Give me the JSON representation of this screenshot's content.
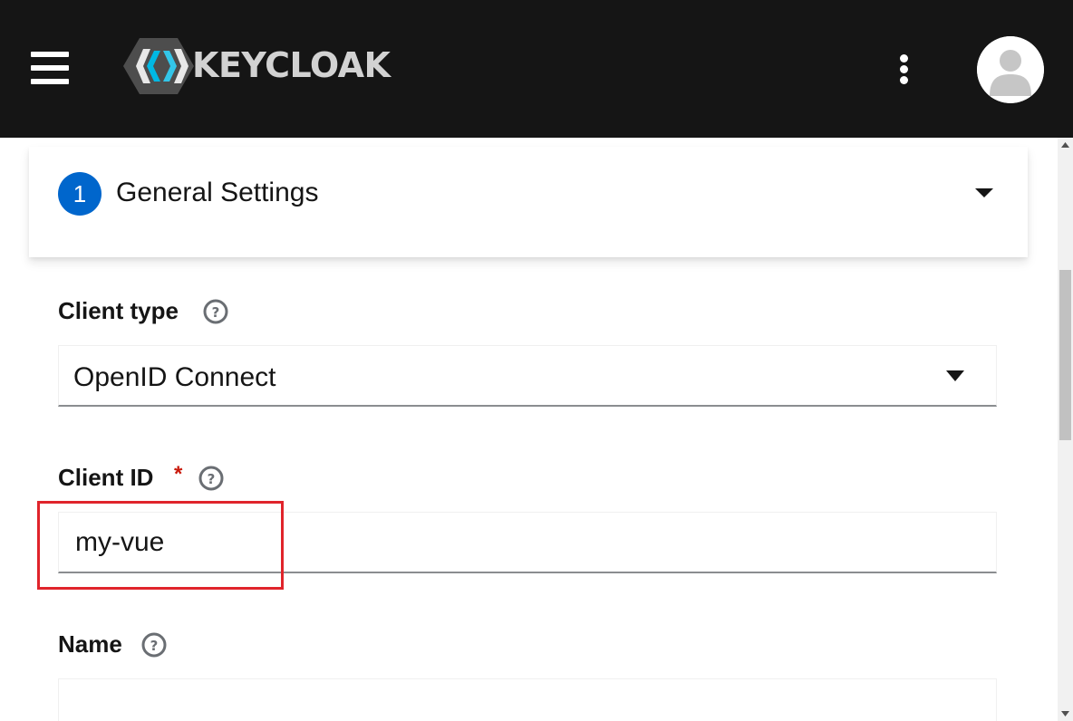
{
  "header": {
    "logo_text": "KEYCLOAK",
    "icons": {
      "menu": "hamburger-menu-icon",
      "options": "kebab-menu-icon",
      "user": "user-avatar-icon"
    },
    "background_color": "#151515"
  },
  "wizard": {
    "step": {
      "number": "1",
      "title": "General Settings",
      "accent_color": "#0066cc"
    }
  },
  "form": {
    "client_type": {
      "label": "Client type",
      "value": "OpenID Connect"
    },
    "client_id": {
      "label": "Client ID",
      "required_mark": "*",
      "value": "my-vue"
    },
    "name": {
      "label": "Name",
      "value": ""
    }
  },
  "annotation": {
    "highlight_color": "#e0242b"
  }
}
